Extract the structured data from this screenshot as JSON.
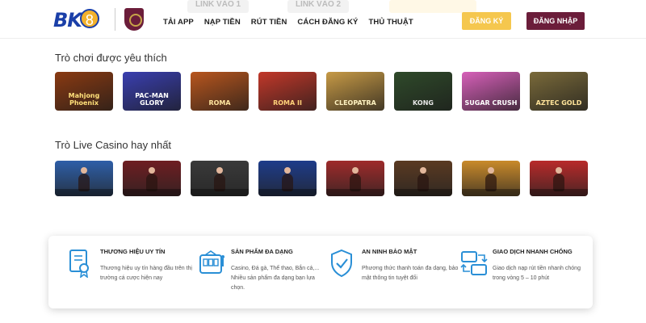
{
  "header": {
    "logo_text": "BK",
    "logo_num": "8",
    "faded_links": [
      "LINK VÀO 1",
      "LINK VÀO 2"
    ],
    "nav": [
      "TẢI APP",
      "NẠP TIỀN",
      "RÚT TIỀN",
      "CÁCH ĐĂNG KÝ",
      "THỦ THUẬT"
    ],
    "register_label": "ĐĂNG KÝ",
    "login_label": "ĐĂNG NHẬP",
    "colors": {
      "brand_blue": "#1a3fa8",
      "register": "#f5c74e",
      "login": "#6b1d3a"
    }
  },
  "favorites": {
    "title": "Trò chơi được yêu thích",
    "games": [
      {
        "caption": "Mahjong Phoenix",
        "color": "#8a3a12",
        "text_color": "#ffe07a"
      },
      {
        "caption": "PAC-MAN GLORY",
        "color": "#3a3fb0",
        "text_color": "#ffffff"
      },
      {
        "caption": "ROMA",
        "color": "#b8561e",
        "text_color": "#ffe6a0"
      },
      {
        "caption": "ROMA II",
        "color": "#c2382a",
        "text_color": "#ffd27a"
      },
      {
        "caption": "CLEOPATRA",
        "color": "#c79a46",
        "text_color": "#fff3c2"
      },
      {
        "caption": "KONG",
        "color": "#2f4a2a",
        "text_color": "#e6e6e6"
      },
      {
        "caption": "SUGAR CRUSH",
        "color": "#d760b9",
        "text_color": "#ffffff"
      },
      {
        "caption": "AZTEC GOLD",
        "color": "#7a6a3a",
        "text_color": "#ffe49a"
      }
    ]
  },
  "live_casino": {
    "title": "Trò Live Casino hay nhất",
    "tables": [
      {
        "color": "#2e5fa8"
      },
      {
        "color": "#6e1e22"
      },
      {
        "color": "#3a3a3a"
      },
      {
        "color": "#1e3c8a"
      },
      {
        "color": "#9e2b2b"
      },
      {
        "color": "#5a3a22"
      },
      {
        "color": "#c98a2a"
      },
      {
        "color": "#b82a2a"
      }
    ]
  },
  "features": [
    {
      "icon": "certificate-icon",
      "title": "THƯƠNG HIỆU UY TÍN",
      "desc": "Thương hiệu uy tín hàng đầu trên thị trường cá cược hiện nay"
    },
    {
      "icon": "slot-machine-icon",
      "title": "SẢN PHẨM ĐA DẠNG",
      "desc": "Casino, Đá gà, Thể thao, Bắn cá,... Nhiều sản phẩm đa dạng bạn lựa chọn."
    },
    {
      "icon": "shield-check-icon",
      "title": "AN NINH BẢO MẬT",
      "desc": "Phương thức thanh toán đa dạng, bảo mật thông tin tuyệt đối"
    },
    {
      "icon": "transfer-icon",
      "title": "GIAO DỊCH NHANH CHÓNG",
      "desc": "Giao dịch nạp rút tiền nhanh chóng trong vòng 5 – 10 phút"
    }
  ]
}
